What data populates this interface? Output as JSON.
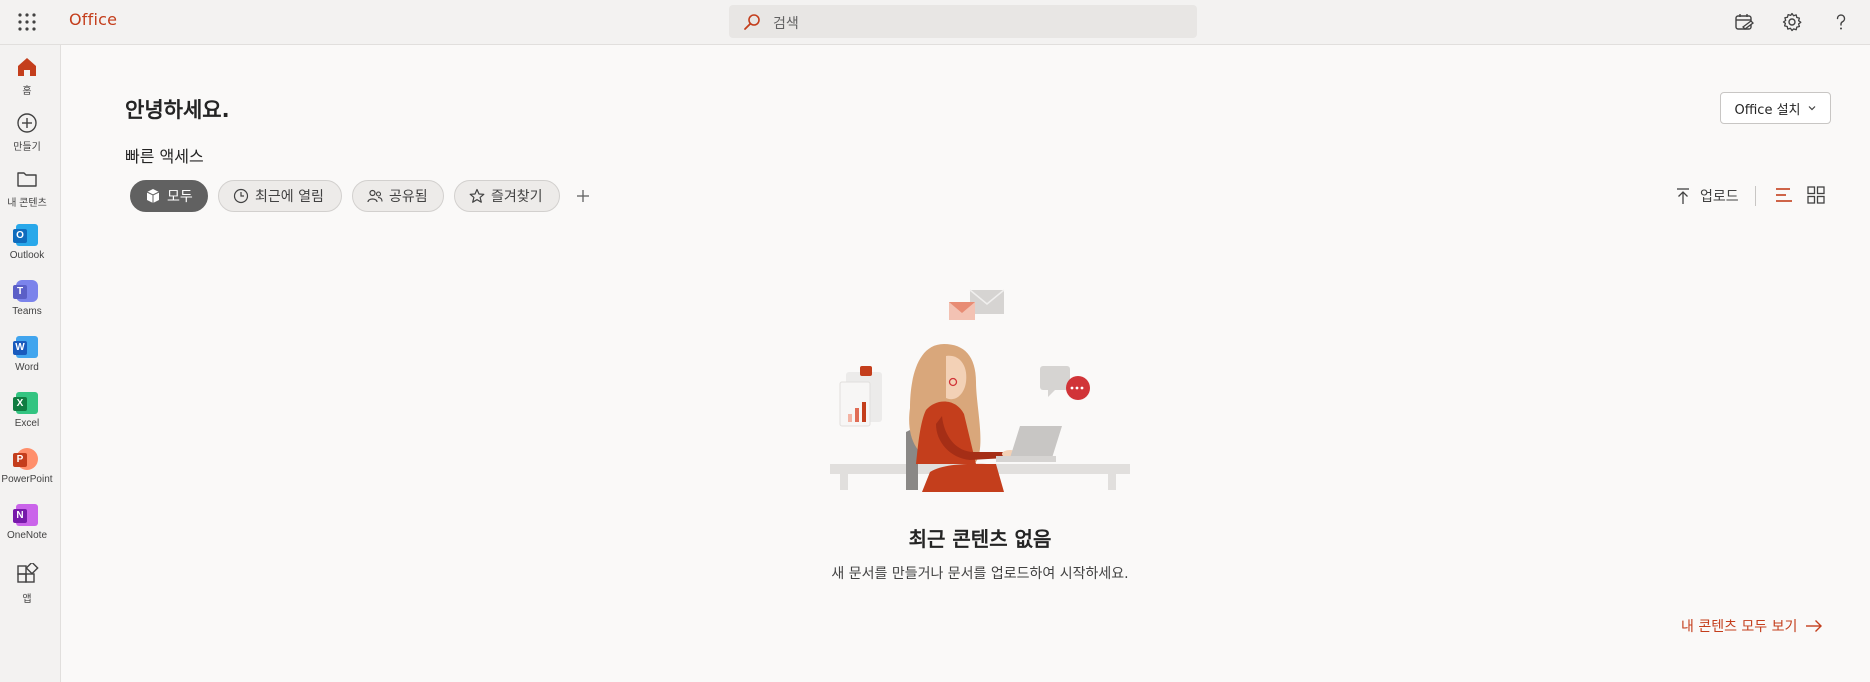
{
  "topbar": {
    "brand": "Office",
    "search_placeholder": "검색"
  },
  "rail": {
    "items": [
      {
        "label": "홈",
        "icon": "home-icon"
      },
      {
        "label": "만들기",
        "icon": "create-icon"
      },
      {
        "label": "내 콘텐츠",
        "icon": "folder-icon"
      },
      {
        "label": "Outlook",
        "icon": "outlook-icon"
      },
      {
        "label": "Teams",
        "icon": "teams-icon"
      },
      {
        "label": "Word",
        "icon": "word-icon"
      },
      {
        "label": "Excel",
        "icon": "excel-icon"
      },
      {
        "label": "PowerPoint",
        "icon": "powerpoint-icon"
      },
      {
        "label": "OneNote",
        "icon": "onenote-icon"
      },
      {
        "label": "앱",
        "icon": "apps-icon"
      }
    ]
  },
  "main": {
    "greeting": "안녕하세요.",
    "install_button": "Office 설치",
    "quick_access_title": "빠른 액세스",
    "filters": [
      {
        "label": "모두",
        "active": true
      },
      {
        "label": "최근에 열림",
        "active": false
      },
      {
        "label": "공유됨",
        "active": false
      },
      {
        "label": "즐겨찾기",
        "active": false
      }
    ],
    "upload_label": "업로드",
    "empty_title": "최근 콘텐츠 없음",
    "empty_subtitle": "새 문서를 만들거나 문서를 업로드하여 시작하세요.",
    "see_all": "내 콘텐츠 모두 보기"
  },
  "colors": {
    "accent": "#c43e1c",
    "outlook": "#0f6cbd",
    "teams": "#5b5fc7",
    "word": "#185abd",
    "excel": "#107c41",
    "powerpoint": "#c43e1c",
    "onenote": "#7719aa"
  }
}
